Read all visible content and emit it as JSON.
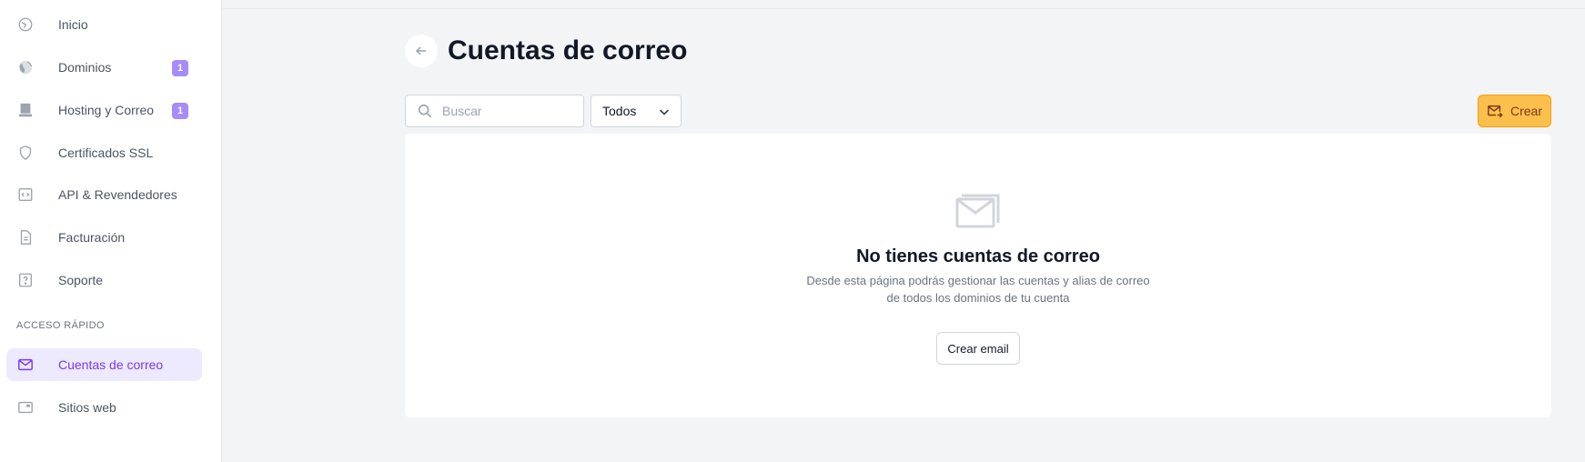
{
  "sidebar": {
    "items": [
      {
        "label": "Inicio",
        "icon": "home-icon"
      },
      {
        "label": "Dominios",
        "icon": "globe-icon",
        "badge": "1"
      },
      {
        "label": "Hosting y Correo",
        "icon": "server-icon",
        "badge": "1"
      },
      {
        "label": "Certificados SSL",
        "icon": "shield-icon"
      },
      {
        "label": "API & Revendedores",
        "icon": "code-icon"
      },
      {
        "label": "Facturación",
        "icon": "document-icon"
      },
      {
        "label": "Soporte",
        "icon": "help-icon"
      }
    ],
    "section_title": "ACCESO RÁPIDO",
    "quick": [
      {
        "label": "Cuentas de correo",
        "icon": "mail-icon",
        "active": true
      },
      {
        "label": "Sitios web",
        "icon": "browser-window-icon"
      }
    ]
  },
  "header": {
    "title": "Cuentas de correo",
    "back_icon": "arrow-left-icon"
  },
  "toolbar": {
    "search_placeholder": "Buscar",
    "filter_value": "Todos",
    "create_label": "Crear"
  },
  "empty_state": {
    "icon": "mail-envelope-icon",
    "title": "No tienes cuentas de correo",
    "desc_line1": "Desde esta página podrás gestionar las cuentas y alias de correo",
    "desc_line2": "de todos los dominios de tu cuenta",
    "button_label": "Crear email"
  },
  "colors": {
    "accent": "#7c3aed",
    "badge": "#a78bfa",
    "create_button": "#fbbf4c",
    "background": "#f3f4f6"
  }
}
